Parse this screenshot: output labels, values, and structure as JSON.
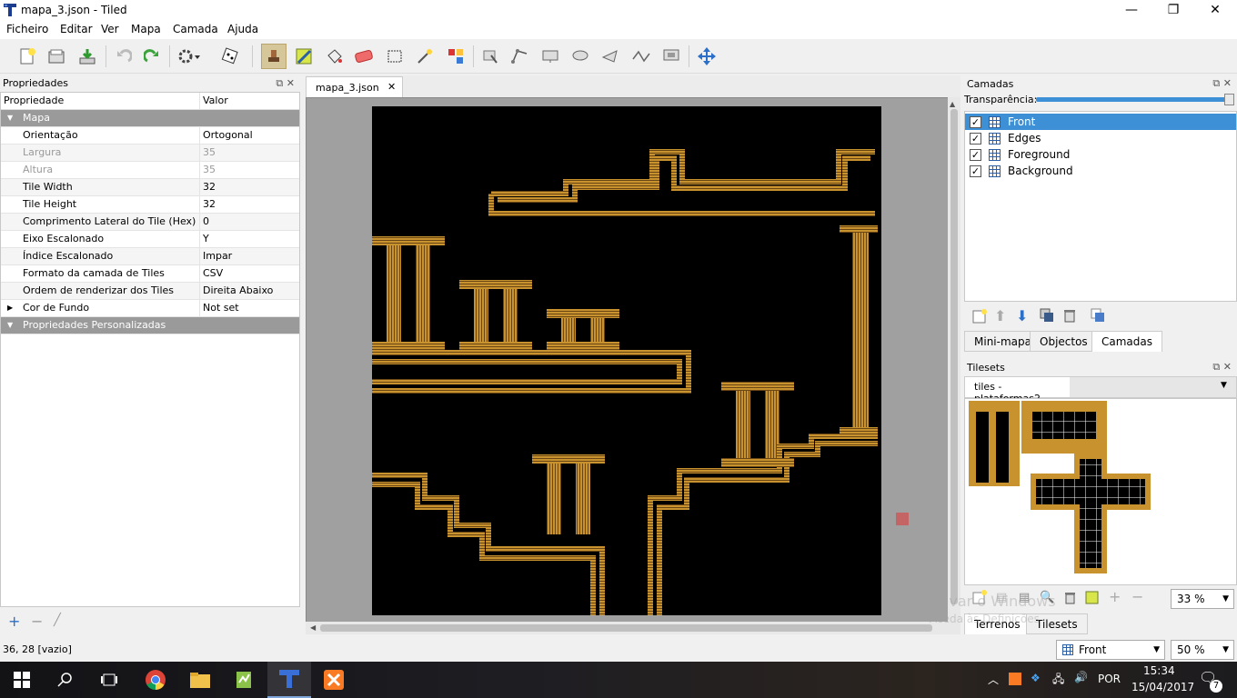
{
  "window": {
    "title": "mapa_3.json - Tiled",
    "minimize": "—",
    "maximize": "❐",
    "close": "✕"
  },
  "menu": [
    "Ficheiro",
    "Editar",
    "Ver",
    "Mapa",
    "Camada",
    "Ajuda"
  ],
  "toolbar_icons": [
    "new-map-icon",
    "open-icon",
    "save-icon",
    "undo-icon",
    "redo-icon",
    "command-icon",
    "random-icon",
    "stamp-brush-icon",
    "terrain-brush-icon",
    "bucket-fill-icon",
    "eraser-icon",
    "rect-select-icon",
    "magic-wand-icon",
    "select-same-tile-icon",
    "select-objects-icon",
    "edit-polygons-icon",
    "insert-rectangle-icon",
    "insert-ellipse-icon",
    "insert-polygon-icon",
    "insert-polyline-icon",
    "insert-tile-icon",
    "move-icon"
  ],
  "properties": {
    "panel_title": "Propriedades",
    "col_property": "Propriedade",
    "col_value": "Valor",
    "group_map": "Mapa",
    "rows": [
      {
        "name": "Orientação",
        "value": "Ortogonal",
        "disabled": false
      },
      {
        "name": "Largura",
        "value": "35",
        "disabled": true
      },
      {
        "name": "Altura",
        "value": "35",
        "disabled": true
      },
      {
        "name": "Tile Width",
        "value": "32",
        "disabled": false
      },
      {
        "name": "Tile Height",
        "value": "32",
        "disabled": false
      },
      {
        "name": "Comprimento Lateral do Tile (Hex)",
        "value": "0",
        "disabled": false
      },
      {
        "name": "Eixo Escalonado",
        "value": "Y",
        "disabled": false
      },
      {
        "name": "Índice Escalonado",
        "value": "Impar",
        "disabled": false
      },
      {
        "name": "Formato da camada de Tiles",
        "value": "CSV",
        "disabled": false
      },
      {
        "name": "Ordem de renderizar dos Tiles",
        "value": "Direita Abaixo",
        "disabled": false
      },
      {
        "name": "Cor de Fundo",
        "value": "Not set",
        "disabled": false
      }
    ],
    "group_custom": "Propriedades Personalizadas"
  },
  "document_tab": {
    "label": "mapa_3.json",
    "close": "✕"
  },
  "layers": {
    "panel_title": "Camadas",
    "opacity_label": "Transparência:",
    "opacity": 1.0,
    "items": [
      {
        "name": "Front",
        "visible": true,
        "selected": true
      },
      {
        "name": "Edges",
        "visible": true,
        "selected": false
      },
      {
        "name": "Foreground",
        "visible": true,
        "selected": false
      },
      {
        "name": "Background",
        "visible": true,
        "selected": false
      }
    ],
    "tabs": [
      "Mini-mapa",
      "Objectos",
      "Camadas"
    ],
    "active_tab": "Camadas"
  },
  "tilesets": {
    "panel_title": "Tilesets",
    "tab_label": "tiles - plataformas2",
    "zoom": "33 %",
    "tabs": [
      "Terrenos",
      "Tilesets"
    ]
  },
  "status": {
    "coords": "36, 28 [vazio]",
    "layer_select": "Front",
    "zoom": "50 %"
  },
  "watermark": {
    "line1": "Ativar o Windows",
    "line2": "Aceda às Definições"
  },
  "taskbar": {
    "language": "POR",
    "time": "15:34",
    "date": "15/04/2017",
    "notifications": "7"
  },
  "colors": {
    "accent_selection": "#3d8fd6",
    "tile_gold": "#c8922e",
    "map_bg": "#000000",
    "group_header": "#9a9a9a"
  }
}
